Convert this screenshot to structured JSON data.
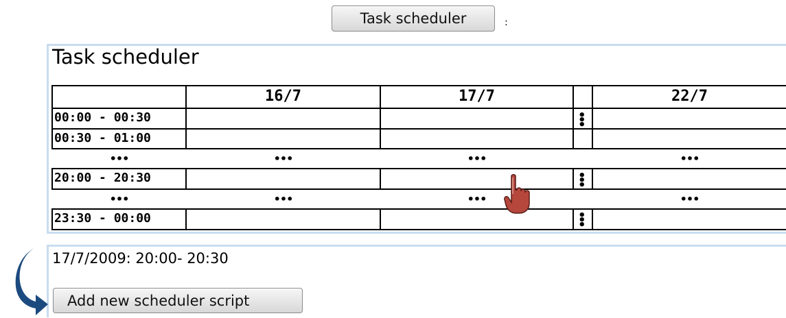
{
  "top_button": {
    "label": "Task scheduler"
  },
  "colon": ":",
  "scheduler": {
    "title": "Task scheduler",
    "columns": [
      "16/7",
      "17/7",
      "22/7"
    ],
    "rows": [
      "00:00 - 00:30",
      "00:30 - 01:00",
      "20:00 - 20:30",
      "23:30 - 00:00"
    ],
    "ellipsis": "•••"
  },
  "selection": {
    "text": "17/7/2009: 20:00- 20:30",
    "add_button_label": "Add new scheduler script"
  },
  "icons": {
    "cursor": "hand-pointer-icon",
    "arrow": "curved-arrow-icon"
  },
  "colors": {
    "panel_border": "#c8dcef",
    "arrow": "#1b4a7e",
    "cursor": "#b5473c"
  }
}
